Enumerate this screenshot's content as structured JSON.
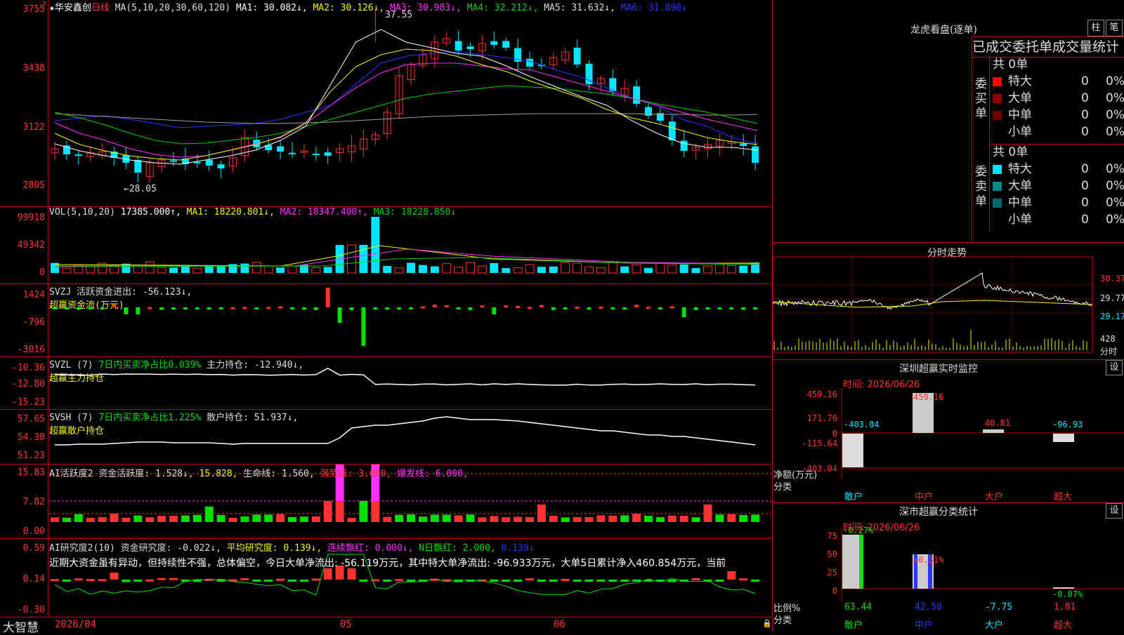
{
  "colors": {
    "up": "#ff3232",
    "down": "#00e5ff",
    "grid": "#c00000",
    "ma1": "#ffffff",
    "ma2": "#f5f500",
    "ma3": "#ff30ff",
    "ma4": "#00d000",
    "ma5": "#a0a0a0",
    "ma6": "#2a35ff",
    "green": "#00e000"
  },
  "top_icon": "question-mark-icon",
  "price": {
    "stock_name": "华安鑫创",
    "period": "日线",
    "ma_params": "MA(5,10,20,30,60,120)",
    "ma1": "MA1: 30.082↓,",
    "ma2": "MA2: 30.126↓,",
    "ma3": "MA3: 30.983↓,",
    "ma4": "MA4: 32.212↓,",
    "ma5": "MA5: 31.632↓,",
    "ma6": "MA6: 31.890↓",
    "y_labels": [
      "3755",
      "3438",
      "3122",
      "2805"
    ],
    "high_label": "37.55",
    "low_label": "←28.05"
  },
  "vol": {
    "header": "VOL(5,10,20)",
    "value": "17385.000↑,",
    "ma1": "MA1: 18220.801↓,",
    "ma2": "MA2: 18347.400↑,",
    "ma3": "MA3: 18228.850↓",
    "y_labels": [
      "99918",
      "49342",
      "0"
    ]
  },
  "svzj": {
    "name": "SVZJ",
    "label": "活跃资金进出: -56.123↓,",
    "subtitle": "超赢资金流(万元)",
    "y_labels": [
      "1424",
      "-796",
      "-3016"
    ]
  },
  "svzl": {
    "name": "SVZL (7)",
    "ratio": "7日内买卖净占比0.039%",
    "hold": "主力持仓: -12.940↓,",
    "subtitle": "超赢主力持仓",
    "y_labels": [
      "-10.36",
      "-12.80",
      "-15.23"
    ]
  },
  "svsh": {
    "name": "SVSH (7)",
    "ratio": "7日内买卖净占比1.225%",
    "hold": "散户持仓: 51.937↓,",
    "subtitle": "超赢散户持仓",
    "y_labels": [
      "57.65",
      "54.38",
      "51.23"
    ]
  },
  "ai1": {
    "name": "AI活跃度2",
    "active": "资金活跃度: 1.528↓,",
    "v2": "15.828,",
    "life": "生命线: 1.560,",
    "strong": "强势线: 3.000,",
    "burst": "爆发线: 6.000,",
    "y_labels": [
      "15.83",
      "7.82",
      "0.00"
    ]
  },
  "ai2": {
    "name": "AI研究度2(10)",
    "research": "资金研究度: -0.022↓,",
    "avg": "平均研究度: 0.139↓,",
    "cont": "连续飘红: 0.000↓,",
    "nday": "N日飘红: 2.000,",
    "last": "0.139↓",
    "text": "近期大资金虽有异动，但持续性不强，总体偏空，今日大单净流出: -56.119万元，其中特大单净流出: -96.933万元，大单5日累计净入460.854万元，当前",
    "y_labels": [
      "0.59",
      "0.14",
      "-0.30"
    ]
  },
  "xaxis": {
    "brand": "大智慧",
    "d1": "2026/04",
    "d2": "05",
    "d3": "06"
  },
  "dragon": {
    "title": "龙虎看盘(逐单)",
    "btn1": "柱",
    "btn2": "笔",
    "subtitle": "已成交委托单成交量统计",
    "buy_label": "委买单",
    "sell_label": "委卖单",
    "buy_total": "共 0单",
    "sell_total": "共 0单",
    "buy_rows": [
      {
        "name": "特大",
        "val": "0",
        "pct": "0%"
      },
      {
        "name": "大单",
        "val": "0",
        "pct": "0%"
      },
      {
        "name": "中单",
        "val": "0",
        "pct": "0%"
      },
      {
        "name": "小单",
        "val": "0",
        "pct": "0%"
      }
    ],
    "sell_rows": [
      {
        "name": "特大",
        "val": "0",
        "pct": "0%"
      },
      {
        "name": "大单",
        "val": "0",
        "pct": "0%"
      },
      {
        "name": "中单",
        "val": "0",
        "pct": "0%"
      },
      {
        "name": "小单",
        "val": "0",
        "pct": "0%"
      }
    ]
  },
  "intraday": {
    "title": "分时走势",
    "y_labels": [
      "30.37",
      "29.77",
      "29.17"
    ],
    "vol_label": "428",
    "vol_unit": "分时"
  },
  "monitor": {
    "title": "深圳超赢实时监控",
    "btn": "设",
    "time": "时间: 2026/06/26",
    "y_labels": [
      "459.16",
      "171.76",
      "0",
      "-115.64",
      "-403.04"
    ],
    "net_label": "净额(万元)",
    "cat_label": "分类",
    "values": [
      "-403.04",
      "459.16",
      "40.81",
      "-96.93"
    ],
    "cats": [
      "散户",
      "中户",
      "大户",
      "超大"
    ]
  },
  "classify": {
    "title": "深市超赢分类统计",
    "btn": "设",
    "time": "时间: 2026/06/26",
    "y_labels": [
      "75",
      "50",
      "25",
      "0"
    ],
    "ratio_label": "比例%",
    "cat_label": "分类",
    "pct_top": [
      "-0.27%",
      "+0.31%",
      "-0.07%"
    ],
    "bottom_vals": [
      "63.44",
      "42.50",
      "-7.75",
      "1.81"
    ],
    "cats": [
      "散户",
      "中户",
      "大户",
      "超大"
    ]
  }
}
